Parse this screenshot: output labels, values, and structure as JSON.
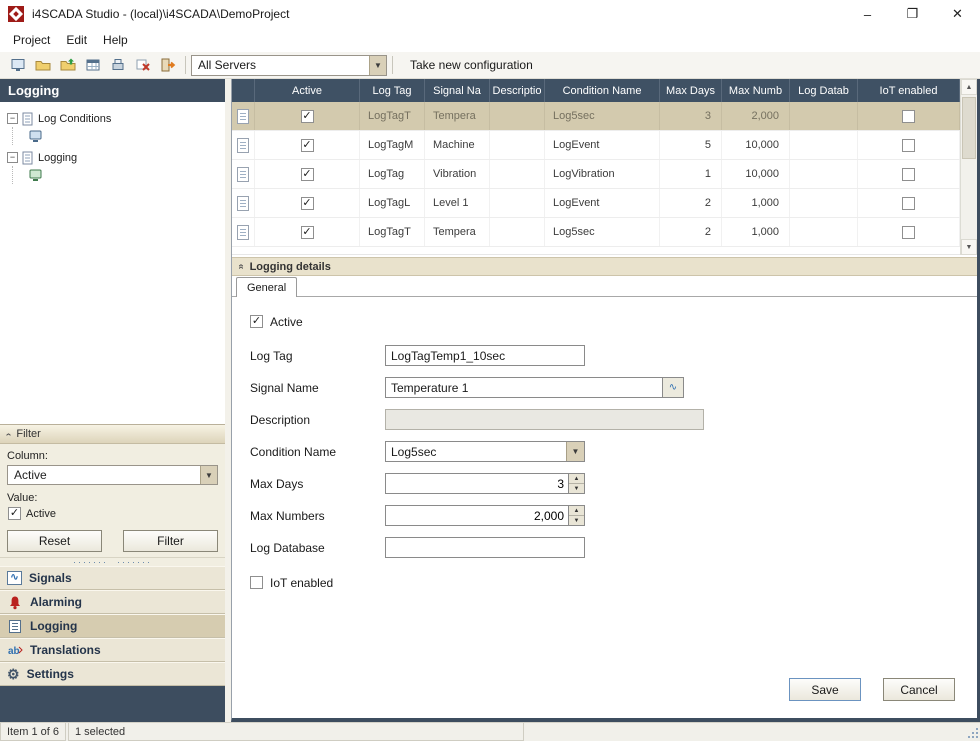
{
  "window": {
    "title": "i4SCADA Studio - (local)\\i4SCADA\\DemoProject",
    "minimize_glyph": "–",
    "maximize_glyph": "❐",
    "close_glyph": "✕"
  },
  "menu": {
    "items": [
      "Project",
      "Edit",
      "Help"
    ]
  },
  "toolbar": {
    "server_selector_value": "All Servers",
    "take_new_configuration_label": "Take new configuration"
  },
  "sidebar": {
    "title": "Logging",
    "tree": {
      "node1_label": "Log Conditions",
      "node2_label": "Logging"
    },
    "filter": {
      "header": "Filter",
      "column_label": "Column:",
      "column_value": "Active",
      "value_label": "Value:",
      "value_option": "Active",
      "value_checked": true,
      "reset_label": "Reset",
      "filter_label": "Filter"
    },
    "nav": {
      "items": [
        {
          "label": "Signals",
          "selected": false
        },
        {
          "label": "Alarming",
          "selected": false
        },
        {
          "label": "Logging",
          "selected": true
        },
        {
          "label": "Translations",
          "selected": false
        },
        {
          "label": "Settings",
          "selected": false
        }
      ]
    }
  },
  "grid": {
    "columns": [
      "Active",
      "Log Tag",
      "Signal Na",
      "Descriptio",
      "Condition Name",
      "Max Days",
      "Max Numb",
      "Log Datab",
      "IoT enabled"
    ],
    "rows": [
      {
        "selected": true,
        "active": true,
        "log_tag": "LogTagT",
        "signal_name": "Tempera",
        "description": "",
        "condition_name": "Log5sec",
        "max_days": "3",
        "max_numbers": "2,000",
        "log_database": "",
        "iot_enabled": false
      },
      {
        "selected": false,
        "active": true,
        "log_tag": "LogTagM",
        "signal_name": "Machine",
        "description": "",
        "condition_name": "LogEvent",
        "max_days": "5",
        "max_numbers": "10,000",
        "log_database": "",
        "iot_enabled": false
      },
      {
        "selected": false,
        "active": true,
        "log_tag": "LogTag",
        "signal_name": "Vibration",
        "description": "",
        "condition_name": "LogVibration",
        "max_days": "1",
        "max_numbers": "10,000",
        "log_database": "",
        "iot_enabled": false
      },
      {
        "selected": false,
        "active": true,
        "log_tag": "LogTagL",
        "signal_name": "Level 1",
        "description": "",
        "condition_name": "LogEvent",
        "max_days": "2",
        "max_numbers": "1,000",
        "log_database": "",
        "iot_enabled": false
      },
      {
        "selected": false,
        "active": true,
        "log_tag": "LogTagT",
        "signal_name": "Tempera",
        "description": "",
        "condition_name": "Log5sec",
        "max_days": "2",
        "max_numbers": "1,000",
        "log_database": "",
        "iot_enabled": false
      }
    ]
  },
  "details": {
    "header": "Logging details",
    "tab_label": "General",
    "active_label": "Active",
    "active_checked": true,
    "fields": {
      "log_tag": {
        "label": "Log Tag",
        "value": "LogTagTemp1_10sec"
      },
      "signal_name": {
        "label": "Signal Name",
        "value": "Temperature 1"
      },
      "description": {
        "label": "Description",
        "value": ""
      },
      "condition_name": {
        "label": "Condition Name",
        "value": "Log5sec"
      },
      "max_days": {
        "label": "Max Days",
        "value": "3"
      },
      "max_numbers": {
        "label": "Max Numbers",
        "value": "2,000"
      },
      "log_database": {
        "label": "Log Database",
        "value": ""
      }
    },
    "iot_label": "IoT enabled",
    "iot_checked": false,
    "save_label": "Save",
    "cancel_label": "Cancel"
  },
  "statusbar": {
    "item_count": "Item 1 of 6",
    "selection": "1 selected"
  },
  "colors": {
    "header_navy": "#3f5164",
    "selected_row_tan": "#d3caae",
    "panel_beige": "#f1eee1",
    "logo_red": "#9e1b17"
  }
}
